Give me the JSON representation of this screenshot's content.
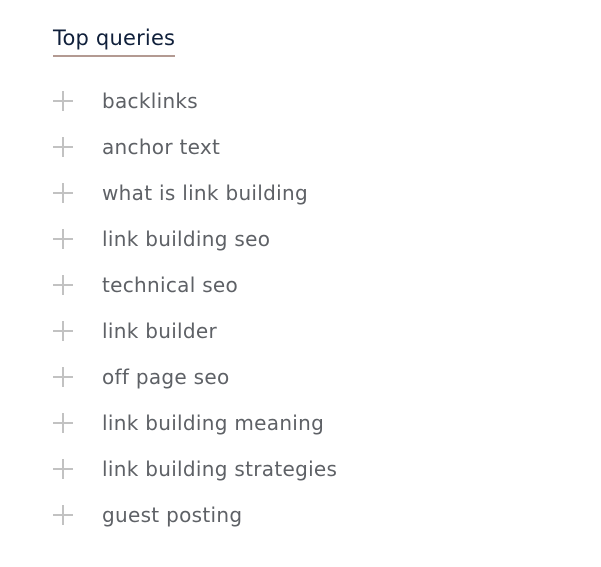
{
  "section": {
    "title": "Top queries",
    "colors": {
      "title": "#0f1f3a",
      "underline": "#b39a92",
      "item_text": "#5e6166",
      "plus_icon": "#c2c2c2"
    },
    "items": [
      {
        "label": "backlinks",
        "icon": "plus-icon"
      },
      {
        "label": "anchor text",
        "icon": "plus-icon"
      },
      {
        "label": "what is link building",
        "icon": "plus-icon"
      },
      {
        "label": "link building seo",
        "icon": "plus-icon"
      },
      {
        "label": "technical seo",
        "icon": "plus-icon"
      },
      {
        "label": "link builder",
        "icon": "plus-icon"
      },
      {
        "label": "off page seo",
        "icon": "plus-icon"
      },
      {
        "label": "link building meaning",
        "icon": "plus-icon"
      },
      {
        "label": "link building strategies",
        "icon": "plus-icon"
      },
      {
        "label": "guest posting",
        "icon": "plus-icon"
      }
    ]
  }
}
